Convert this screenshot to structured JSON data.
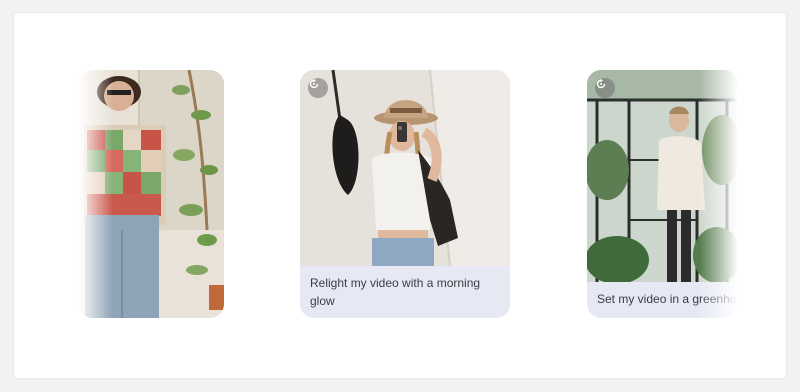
{
  "cards": [
    {
      "caption": "",
      "scene": "woman-in-patchwork-sweater-with-leaves"
    },
    {
      "caption": "Relight my video with a morning glow",
      "badge_icon": "reset-icon",
      "scene": "woman-in-cowboy-hat-mirror-selfie"
    },
    {
      "caption": "Set my video in a greenhouse",
      "badge_icon": "reset-icon",
      "scene": "woman-in-white-jacket-in-greenhouse"
    }
  ],
  "colors": {
    "caption_bg": "#e6e9f4",
    "caption_text": "#3a3d44",
    "panel_bg": "#ffffff",
    "page_bg": "#f1f2f4"
  }
}
